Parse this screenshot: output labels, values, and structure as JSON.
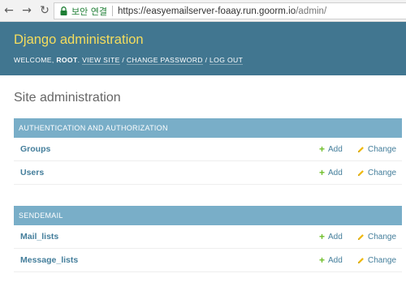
{
  "browser": {
    "secure_label": "보안 연결",
    "url_main": "https://easyemailserver-foaay.run.goorm.io",
    "url_path": "/admin/"
  },
  "header": {
    "brand": "Django administration",
    "welcome": "Welcome,",
    "username": "root",
    "view_site": "View site",
    "change_password": "Change password",
    "log_out": "Log out"
  },
  "content": {
    "title": "Site administration",
    "modules": [
      {
        "caption": "Authentication and Authorization",
        "rows": [
          {
            "model": "Groups",
            "add": "Add",
            "change": "Change"
          },
          {
            "model": "Users",
            "add": "Add",
            "change": "Change"
          }
        ]
      },
      {
        "caption": "Sendemail",
        "rows": [
          {
            "model": "Mail_lists",
            "add": "Add",
            "change": "Change"
          },
          {
            "model": "Message_lists",
            "add": "Add",
            "change": "Change"
          }
        ]
      }
    ]
  },
  "colors": {
    "header_bg": "#417690",
    "brand": "#f5dd5d",
    "caption_bg": "#79aec8",
    "link": "#447e9b",
    "add_icon": "#70bf2b",
    "change_icon": "#efb80b"
  },
  "icons": {
    "back": "back-arrow-icon",
    "forward": "forward-arrow-icon",
    "reload": "reload-icon",
    "secure": "lock-icon",
    "add": "plus-icon",
    "change": "pencil-icon"
  }
}
